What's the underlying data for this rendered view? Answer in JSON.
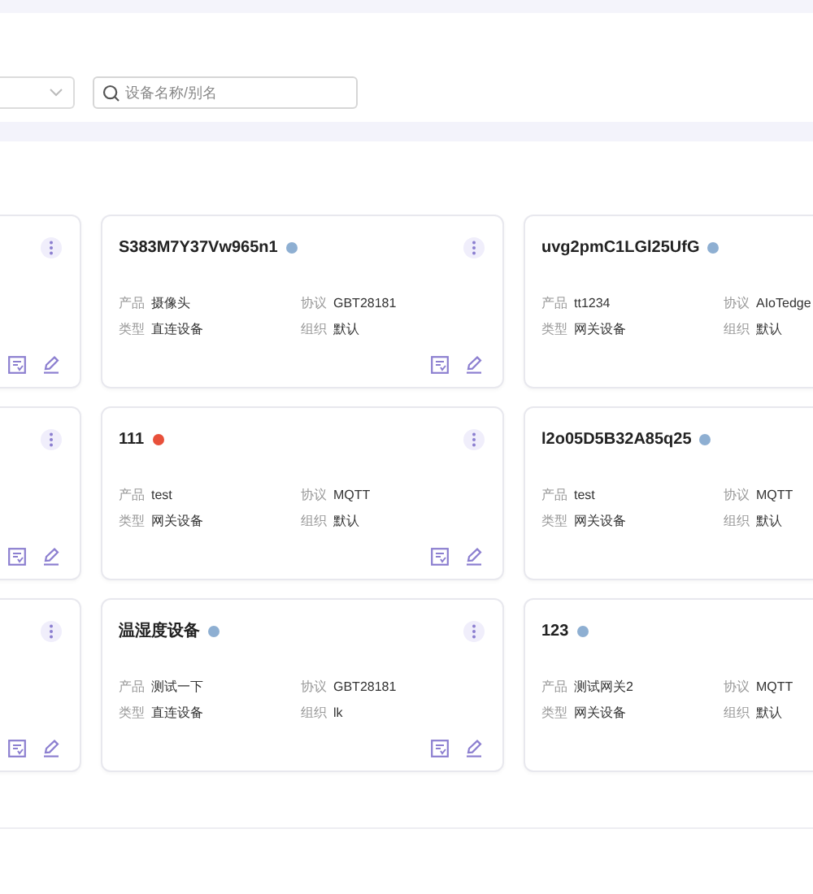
{
  "search": {
    "placeholder": "设备名称/别名"
  },
  "cards": [
    {
      "kind": "clipped"
    },
    {
      "kind": "full",
      "name": "S383M7Y37Vw965n1",
      "color": "#8eafd2",
      "fields": [
        {
          "label": "产品",
          "value": "摄像头"
        },
        {
          "label": "协议",
          "value": "GBT28181"
        },
        {
          "label": "类型",
          "value": "直连设备"
        },
        {
          "label": "组织",
          "value": "默认"
        }
      ]
    },
    {
      "kind": "full",
      "name": "uvg2pmC1LGl25UfG",
      "color": "#8eafd2",
      "fields": [
        {
          "label": "产品",
          "value": "tt1234"
        },
        {
          "label": "协议",
          "value": "AIoTedge"
        },
        {
          "label": "类型",
          "value": "网关设备"
        },
        {
          "label": "组织",
          "value": "默认"
        }
      ]
    },
    {
      "kind": "clipped"
    },
    {
      "kind": "full",
      "name": "111",
      "color": "#e8503a",
      "fields": [
        {
          "label": "产品",
          "value": "test"
        },
        {
          "label": "协议",
          "value": "MQTT"
        },
        {
          "label": "类型",
          "value": "网关设备"
        },
        {
          "label": "组织",
          "value": "默认"
        }
      ]
    },
    {
      "kind": "full",
      "name": "l2o05D5B32A85q25",
      "color": "#8eafd2",
      "fields": [
        {
          "label": "产品",
          "value": "test"
        },
        {
          "label": "协议",
          "value": "MQTT"
        },
        {
          "label": "类型",
          "value": "网关设备"
        },
        {
          "label": "组织",
          "value": "默认"
        }
      ]
    },
    {
      "kind": "clipped"
    },
    {
      "kind": "full",
      "name": "温湿度设备",
      "color": "#8eafd2",
      "fields": [
        {
          "label": "产品",
          "value": "测试一下"
        },
        {
          "label": "协议",
          "value": "GBT28181"
        },
        {
          "label": "类型",
          "value": "直连设备"
        },
        {
          "label": "组织",
          "value": "lk"
        }
      ]
    },
    {
      "kind": "full",
      "name": "123",
      "color": "#8eafd2",
      "fields": [
        {
          "label": "产品",
          "value": "测试网关2"
        },
        {
          "label": "协议",
          "value": "MQTT"
        },
        {
          "label": "类型",
          "value": "网关设备"
        },
        {
          "label": "组织",
          "value": "默认"
        }
      ]
    }
  ]
}
